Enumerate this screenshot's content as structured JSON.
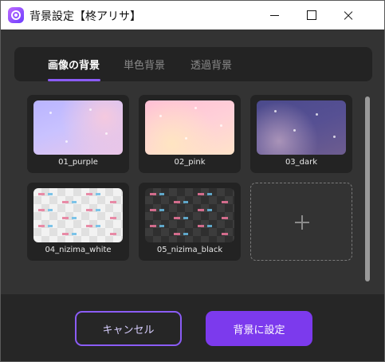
{
  "window": {
    "title": "背景設定【柊アリサ】",
    "app_icon": "app-logo-icon"
  },
  "tabs": [
    {
      "label": "画像の背景",
      "active": true
    },
    {
      "label": "単色背景",
      "active": false
    },
    {
      "label": "透過背景",
      "active": false
    }
  ],
  "backgrounds": [
    {
      "label": "01_purple"
    },
    {
      "label": "02_pink"
    },
    {
      "label": "03_dark"
    },
    {
      "label": "04_nizima_white"
    },
    {
      "label": "05_nizima_black"
    }
  ],
  "add_card": {
    "icon": "plus-icon"
  },
  "footer": {
    "cancel_label": "キャンセル",
    "set_label": "背景に設定"
  },
  "colors": {
    "accent": "#8b5cf6",
    "primary_button": "#7c3aed",
    "background": "#333333"
  }
}
